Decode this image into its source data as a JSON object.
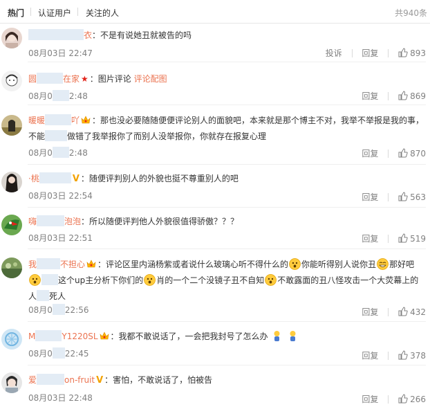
{
  "tabs": [
    "热门",
    "认证用户",
    "关注的人"
  ],
  "total": "共940条",
  "labels": {
    "report": "投诉",
    "reply": "回复"
  },
  "comments": [
    {
      "user_a": "",
      "user_b": "衣",
      "text": "：不是有说她丑就被告的吗",
      "time": "08月03日 22:47",
      "likes": "893"
    },
    {
      "user_a": "圆",
      "user_b": "在家",
      "text": "：图片评论",
      "link": "评论配图",
      "time_a": "08月0",
      "time_b": "2:48",
      "likes": "869"
    },
    {
      "user_a": "暖暖",
      "user_b": "吖",
      "text1": "：那也没必要随随便便评论别人的面貌吧，本来就是那个博主不对，我举不举报是我的事，",
      "text2a": "不能",
      "text2b": "做错了我举报你了而别人没举报你，你就存在报复心理",
      "time_a": "08月0",
      "time_b": "2:48",
      "likes": "870"
    },
    {
      "user_a": "桃",
      "user_b": "",
      "text": "：随便评判别人的外貌也挺不尊重别人的吧",
      "time": "08月03日 22:54",
      "likes": "563"
    },
    {
      "user_a": "嗨",
      "user_b": "泡泡",
      "text": "：所以随便评判他人外貌很值得骄傲？？？",
      "time": "08月03日 22:51",
      "likes": "519"
    },
    {
      "user_a": "我",
      "user_b": "不担心",
      "text1": "：评论区里内涵杨紫或者说什么玻璃心听不得什么的",
      "text1b": "你能听得别人说你丑",
      "text1c": "那好吧",
      "text2a": "这个up主分析下你们的",
      "text2b": "肖的一个二个没镜子丑不自知",
      "text2c": "不敢露面的丑八怪攻击一个大荧幕上的",
      "text3a": "人",
      "text3b": "死人",
      "time_a": "08月0",
      "time_b": "22:56",
      "likes": "432"
    },
    {
      "user_a": "M",
      "user_b": "Y1220SL",
      "text": "：我都不敢说话了，一会把我封号了怎么办",
      "time_a": "08月0",
      "time_b": "22:45",
      "likes": "378"
    },
    {
      "user_a": "爱",
      "user_b": "on-fruit",
      "text": "：害怕，不敢说话了，怕被告",
      "time": "08月03日 22:48",
      "likes": "266"
    }
  ]
}
